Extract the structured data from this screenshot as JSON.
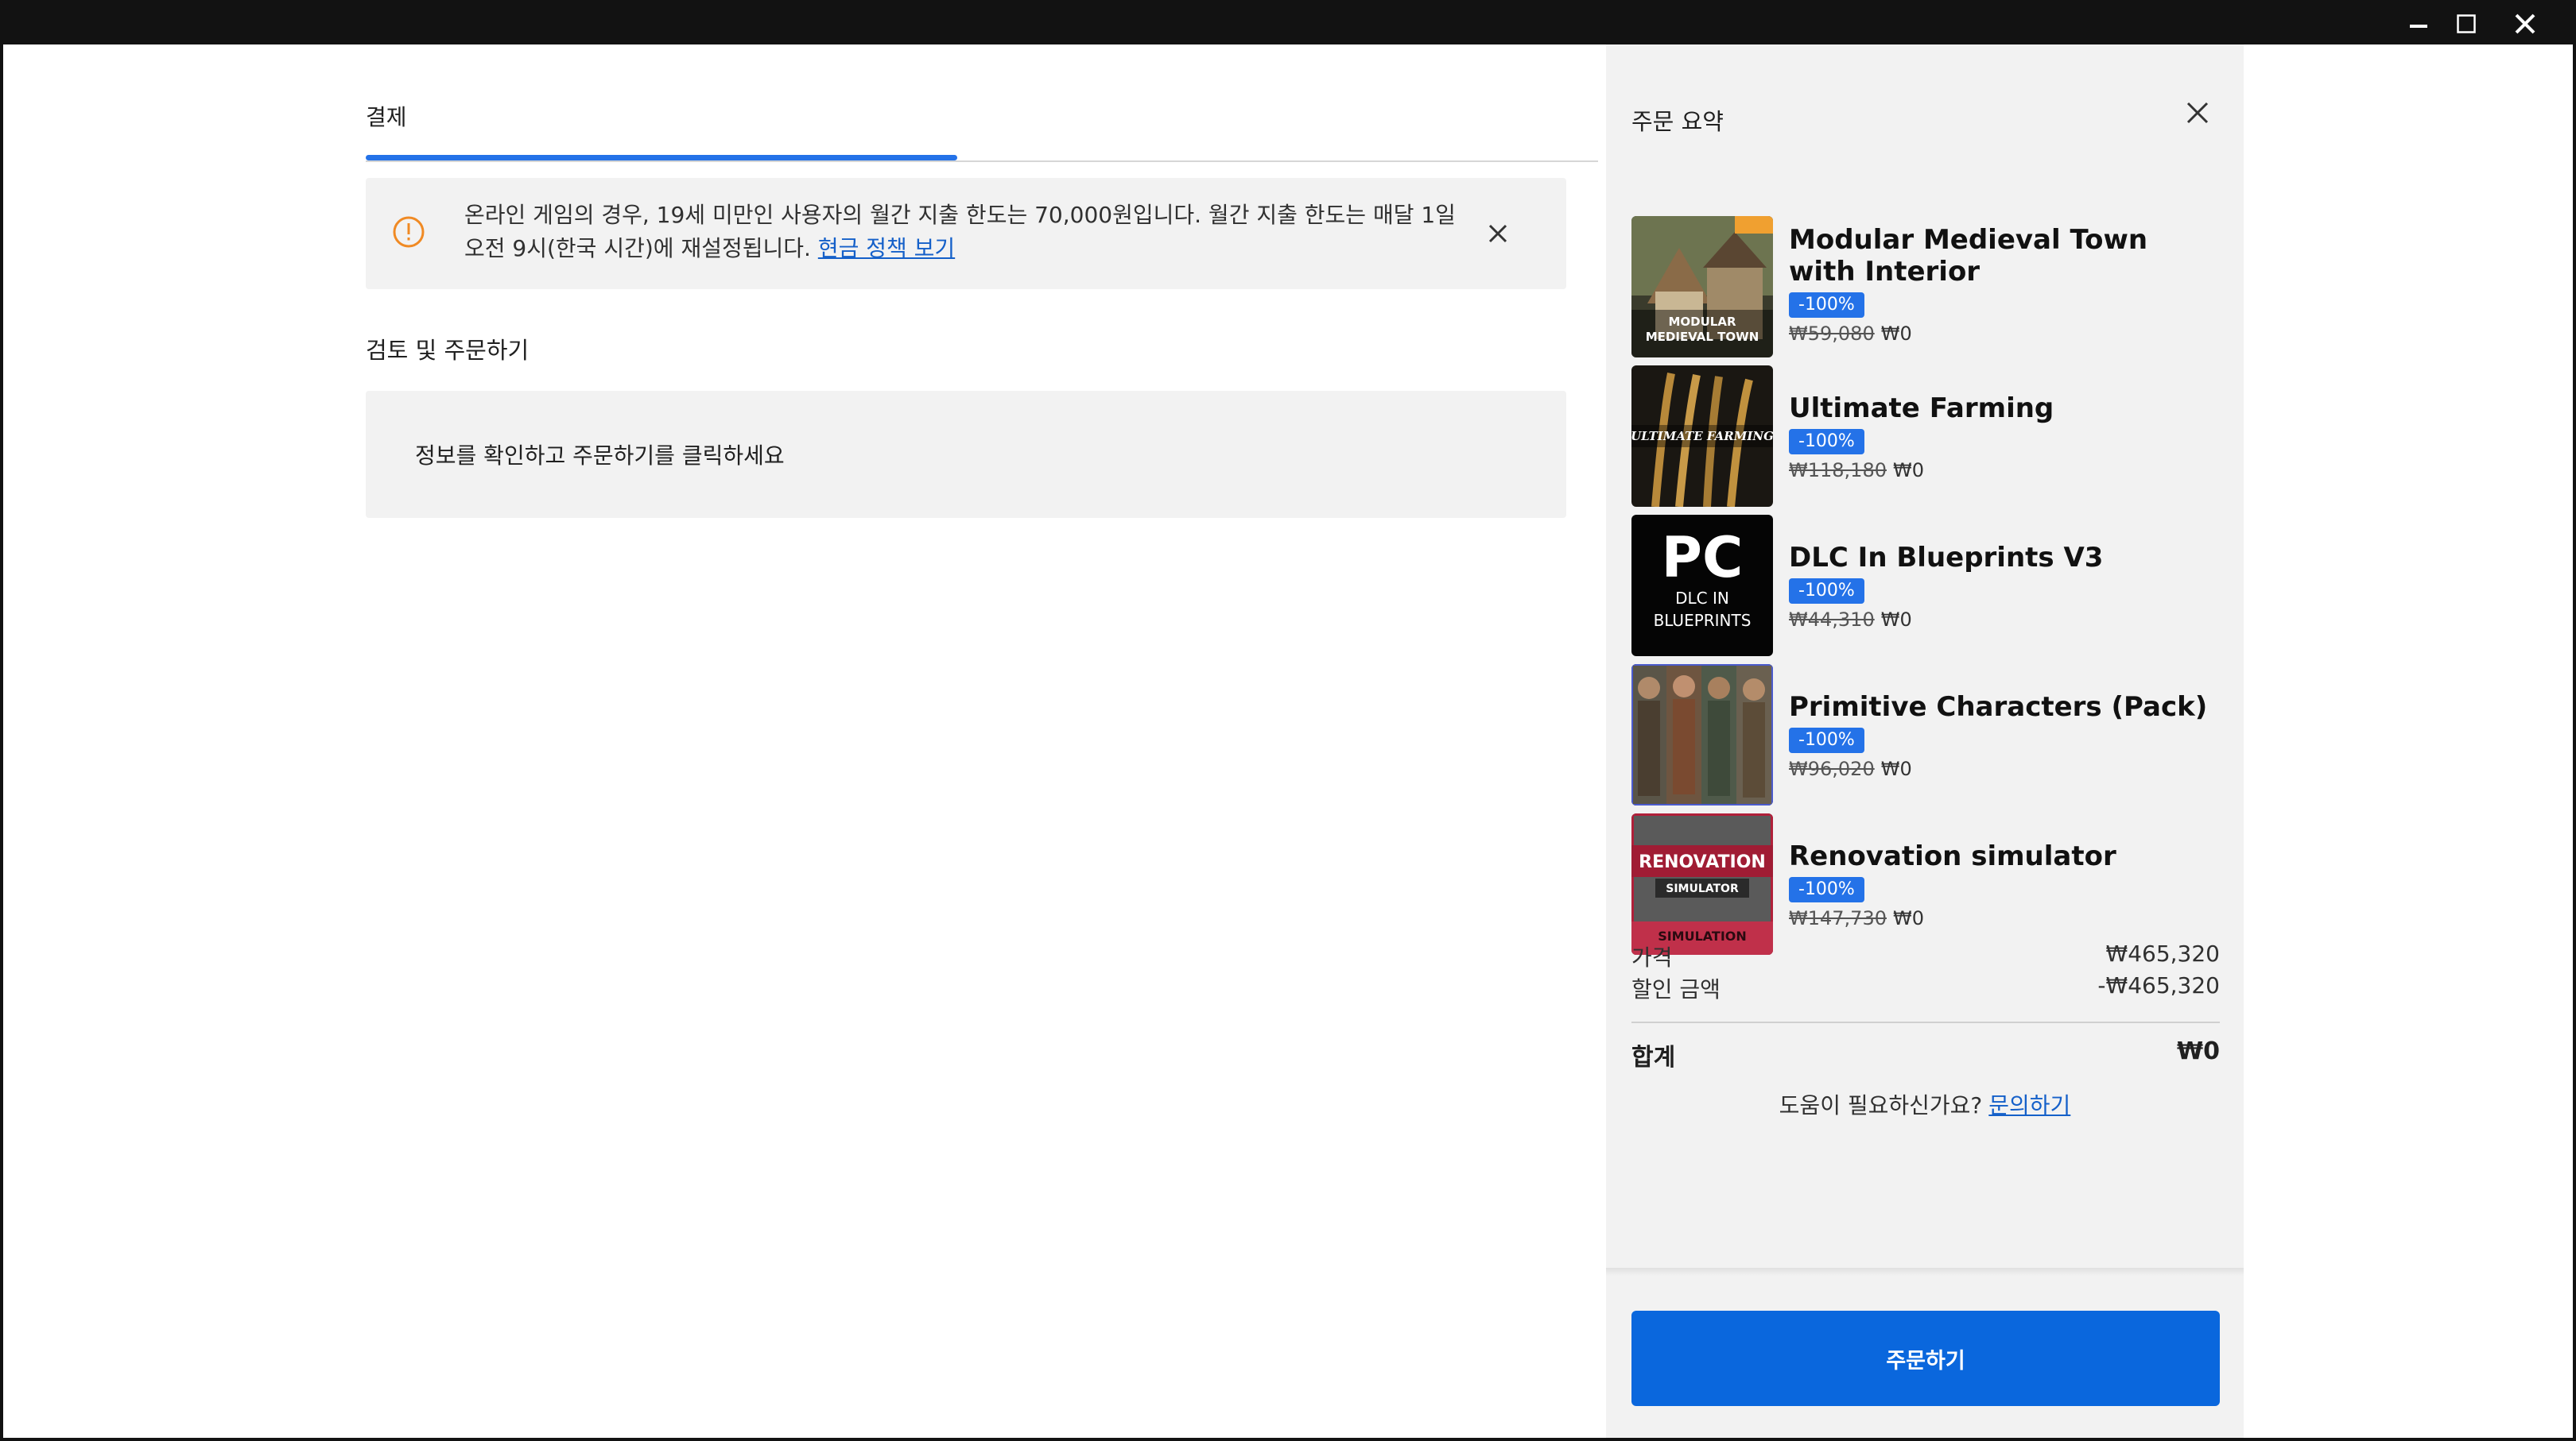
{
  "window": {
    "controls": [
      "minimize",
      "maximize",
      "close"
    ]
  },
  "checkout": {
    "tab_title": "결제",
    "progress": 0.48,
    "notice": {
      "text": "온라인 게임의 경우, 19세 미만인 사용자의 월간 지출 한도는 70,000원입니다. 월간 지출 한도는 매달 1일 오전 9시(한국 시간)에 재설정됩니다.",
      "link": "현금 정책 보기",
      "icon": "warning-circle-icon",
      "icon_color": "#f08a24"
    },
    "section_title": "검토 및 주문하기",
    "review_text": "정보를 확인하고 주문하기를 클릭하세요"
  },
  "summary": {
    "title": "주문 요약",
    "items": [
      {
        "name": "Modular Medieval Town with Interior",
        "badge": "-100%",
        "original_price": "₩59,080",
        "price": "₩0"
      },
      {
        "name": "Ultimate Farming",
        "badge": "-100%",
        "original_price": "₩118,180",
        "price": "₩0"
      },
      {
        "name": "DLC In Blueprints V3",
        "badge": "-100%",
        "original_price": "₩44,310",
        "price": "₩0"
      },
      {
        "name": "Primitive Characters (Pack)",
        "badge": "-100%",
        "original_price": "₩96,020",
        "price": "₩0"
      },
      {
        "name": "Renovation simulator",
        "badge": "-100%",
        "original_price": "₩147,730",
        "price": "₩0"
      }
    ],
    "thumb_labels": {
      "medieval_1": "MODULAR",
      "medieval_2": "MEDIEVAL TOWN",
      "farming": "ULTIMATE FARMING",
      "dlc_1": "PC",
      "dlc_2": "DLC IN",
      "dlc_3": "BLUEPRINTS",
      "reno_1": "RENOVATION",
      "reno_2": "SIMULATOR",
      "reno_3": "SIMULATION"
    },
    "price_label": "가격",
    "price_value": "₩465,320",
    "discount_label": "할인 금액",
    "discount_value": "-₩465,320",
    "total_label": "합계",
    "total_value": "₩0",
    "help_text": "도움이 필요하신가요?",
    "help_link": "문의하기",
    "order_button": "주문하기",
    "accent_color": "#2472e8"
  }
}
